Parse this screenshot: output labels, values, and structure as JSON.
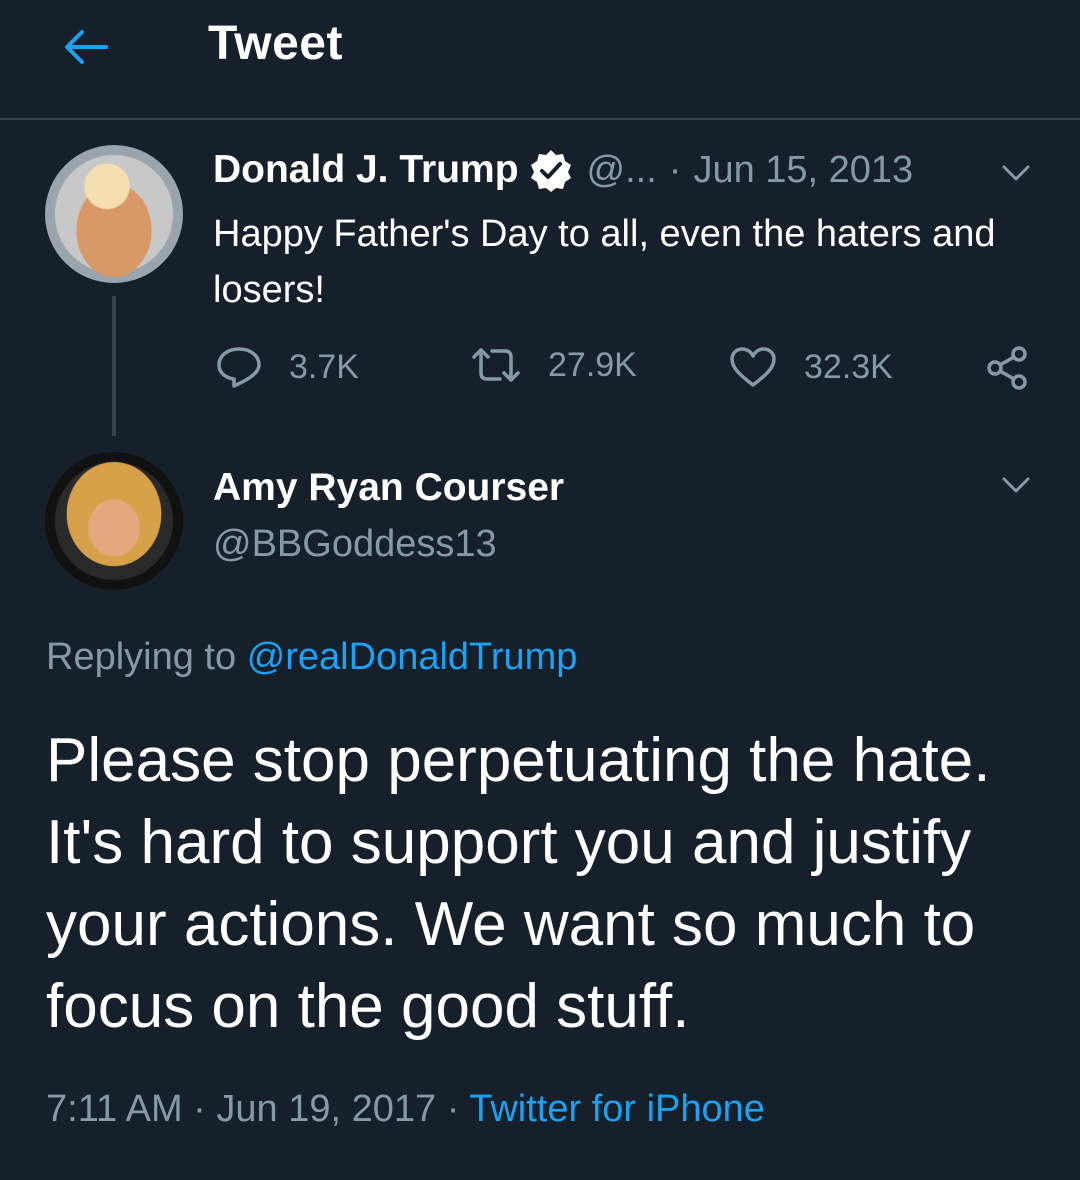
{
  "header": {
    "title": "Tweet"
  },
  "parent_tweet": {
    "display_name": "Donald J. Trump",
    "handle": "@...",
    "separator": "·",
    "date": "Jun 15, 2013",
    "text": "Happy Father's Day to all, even the haters and losers!",
    "stats": {
      "replies": "3.7K",
      "retweets": "27.9K",
      "likes": "32.3K"
    }
  },
  "reply_tweet": {
    "display_name": "Amy Ryan Courser",
    "handle": "@BBGoddess13",
    "replying_label": "Replying to",
    "replying_to": "@realDonaldTrump",
    "text": "Please stop perpetuating the hate. It's hard to support you and justify your actions. We want so much to focus on the good stuff.",
    "time": "7:11 AM",
    "date": "Jun 19, 2017",
    "separator": "·",
    "source": "Twitter for iPhone"
  },
  "colors": {
    "background": "#15202b",
    "secondary_text": "#8899a6",
    "accent": "#1da1f2",
    "divider": "#38444d"
  }
}
